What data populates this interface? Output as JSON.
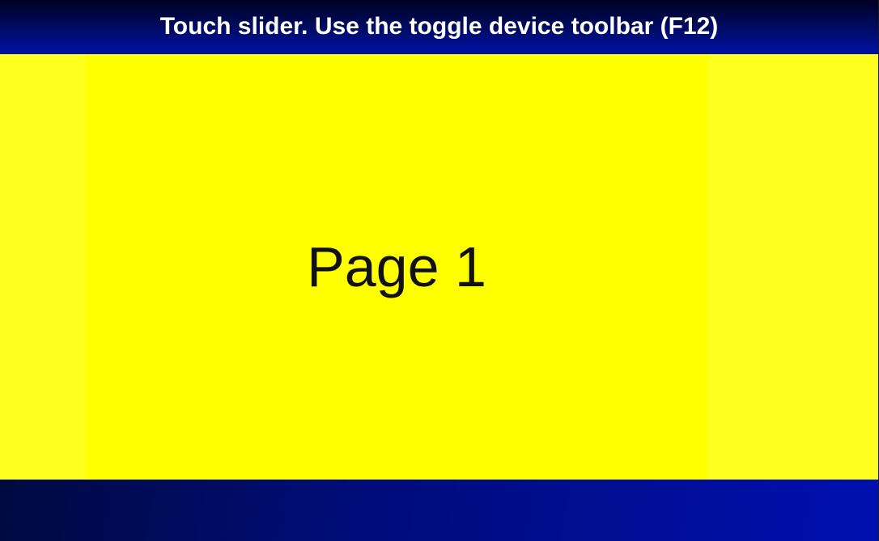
{
  "header": {
    "title": "Touch slider. Use the toggle device toolbar (F12)"
  },
  "slider": {
    "current_slide": {
      "label": "Page 1"
    }
  },
  "colors": {
    "header_gradient_top": "#000020",
    "header_gradient_bottom": "#0012a8",
    "slide_background": "#ffff00",
    "slider_background": "#ffff1f",
    "footer_gradient_start": "#000a40",
    "footer_gradient_end": "#0010b0",
    "header_text": "#ffffff",
    "slide_text": "#111111"
  }
}
